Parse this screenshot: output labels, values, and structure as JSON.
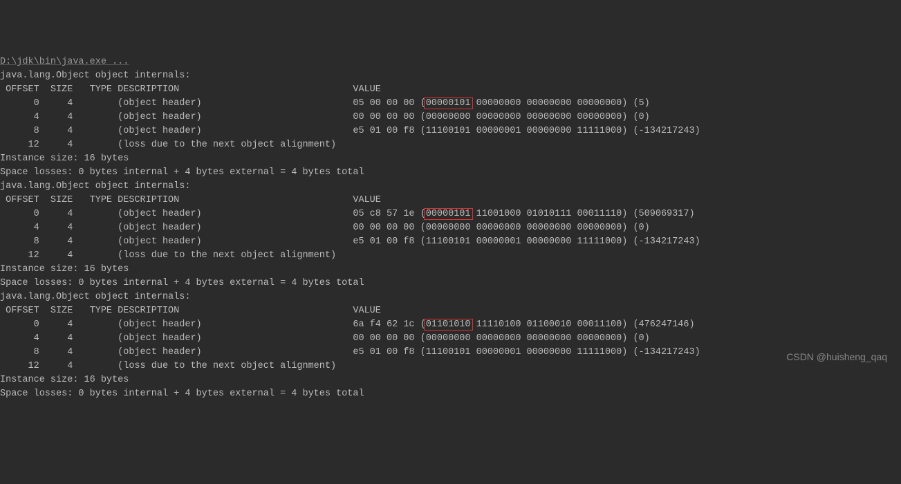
{
  "cmdLine": "D:\\jdk\\bin\\java.exe ...",
  "blocks": [
    {
      "title": "java.lang.Object object internals:",
      "header": " OFFSET  SIZE   TYPE DESCRIPTION                               VALUE",
      "rows": [
        {
          "prefix": "      0     4        (object header)                           05 00 00 00 (",
          "hl": "00000101",
          "suffix": " 00000000 00000000 00000000) (5)"
        },
        {
          "prefix": "      4     4        (object header)                           00 00 00 00 (00000000 00000000 00000000 00000000) (0)",
          "hl": "",
          "suffix": ""
        },
        {
          "prefix": "      8     4        (object header)                           e5 01 00 f8 (11100101 00000001 00000000 11111000) (-134217243)",
          "hl": "",
          "suffix": ""
        },
        {
          "prefix": "     12     4        (loss due to the next object alignment)",
          "hl": "",
          "suffix": ""
        }
      ],
      "footer1": "Instance size: 16 bytes",
      "footer2": "Space losses: 0 bytes internal + 4 bytes external = 4 bytes total"
    },
    {
      "title": "java.lang.Object object internals:",
      "header": " OFFSET  SIZE   TYPE DESCRIPTION                               VALUE",
      "rows": [
        {
          "prefix": "      0     4        (object header)                           05 c8 57 1e (",
          "hl": "00000101",
          "suffix": " 11001000 01010111 00011110) (509069317)"
        },
        {
          "prefix": "      4     4        (object header)                           00 00 00 00 (00000000 00000000 00000000 00000000) (0)",
          "hl": "",
          "suffix": ""
        },
        {
          "prefix": "      8     4        (object header)                           e5 01 00 f8 (11100101 00000001 00000000 11111000) (-134217243)",
          "hl": "",
          "suffix": ""
        },
        {
          "prefix": "     12     4        (loss due to the next object alignment)",
          "hl": "",
          "suffix": ""
        }
      ],
      "footer1": "Instance size: 16 bytes",
      "footer2": "Space losses: 0 bytes internal + 4 bytes external = 4 bytes total"
    },
    {
      "title": "java.lang.Object object internals:",
      "header": " OFFSET  SIZE   TYPE DESCRIPTION                               VALUE",
      "rows": [
        {
          "prefix": "      0     4        (object header)                           6a f4 62 1c (",
          "hl": "01101010",
          "suffix": " 11110100 01100010 00011100) (476247146)"
        },
        {
          "prefix": "      4     4        (object header)                           00 00 00 00 (00000000 00000000 00000000 00000000) (0)",
          "hl": "",
          "suffix": ""
        },
        {
          "prefix": "      8     4        (object header)                           e5 01 00 f8 (11100101 00000001 00000000 11111000) (-134217243)",
          "hl": "",
          "suffix": ""
        },
        {
          "prefix": "     12     4        (loss due to the next object alignment)",
          "hl": "",
          "suffix": ""
        }
      ],
      "footer1": "Instance size: 16 bytes",
      "footer2": "Space losses: 0 bytes internal + 4 bytes external = 4 bytes total"
    }
  ],
  "watermark": "CSDN @huisheng_qaq"
}
